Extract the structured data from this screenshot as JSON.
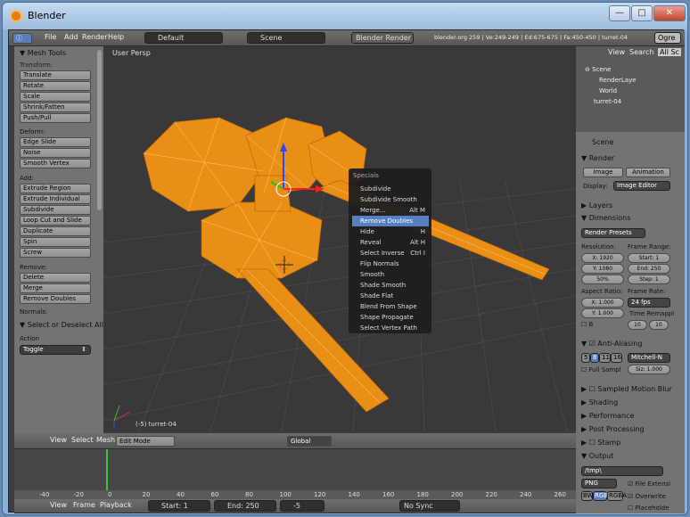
{
  "window": {
    "title": "Blender"
  },
  "info_header": {
    "menu": [
      "File",
      "Add",
      "Render",
      "Help"
    ],
    "layout": "Default",
    "scene": "Scene",
    "engine": "Blender Render",
    "stats": "blender.org 259 | Ve:249-249 | Ed:675-675 | Fa:450-450 | turret-04",
    "search_field": "Ogre"
  },
  "tool_panel": {
    "title": "Mesh Tools",
    "sections": [
      {
        "label": "Transform:",
        "buttons": [
          "Translate",
          "Rotate",
          "Scale",
          "Shrink/Fatten",
          "Push/Pull"
        ]
      },
      {
        "label": "Deform:",
        "buttons": [
          "Edge Slide",
          "Noise",
          "Smooth Vertex"
        ]
      },
      {
        "label": "Add:",
        "buttons": [
          "Extrude Region",
          "Extrude Individual",
          "Subdivide",
          "Loop Cut and Slide",
          "Duplicate",
          "Spin",
          "Screw"
        ]
      },
      {
        "label": "Remove:",
        "buttons": [
          "Delete",
          "Merge",
          "Remove Doubles"
        ]
      },
      {
        "label": "Normals:",
        "buttons": []
      }
    ],
    "operator": {
      "title": "Select or Deselect All",
      "action_label": "Action",
      "action_value": "Toggle"
    }
  },
  "viewport": {
    "label": "User Persp",
    "object_label": "(-5) turret-04"
  },
  "context_menu": {
    "title": "Specials",
    "items": [
      {
        "label": "Subdivide",
        "shortcut": ""
      },
      {
        "label": "Subdivide Smooth",
        "shortcut": ""
      },
      {
        "label": "Merge...",
        "shortcut": "Alt M"
      },
      {
        "label": "Remove Doubles",
        "shortcut": "",
        "selected": true
      },
      {
        "label": "Hide",
        "shortcut": "H"
      },
      {
        "label": "Reveal",
        "shortcut": "Alt H"
      },
      {
        "label": "Select Inverse",
        "shortcut": "Ctrl I"
      },
      {
        "label": "Flip Normals",
        "shortcut": ""
      },
      {
        "label": "Smooth",
        "shortcut": ""
      },
      {
        "label": "Shade Smooth",
        "shortcut": ""
      },
      {
        "label": "Shade Flat",
        "shortcut": ""
      },
      {
        "label": "Blend From Shape",
        "shortcut": ""
      },
      {
        "label": "Shape Propagate",
        "shortcut": ""
      },
      {
        "label": "Select Vertex Path",
        "shortcut": ""
      }
    ]
  },
  "view3d_header": {
    "menu": [
      "View",
      "Select",
      "Mesh"
    ],
    "mode": "Edit Mode",
    "orientation": "Global"
  },
  "outliner": {
    "header": [
      "View",
      "Search",
      "All Sc"
    ],
    "items": [
      "Scene",
      "RenderLaye",
      "World",
      "turret-04"
    ]
  },
  "properties": {
    "breadcrumb": "Scene",
    "render": {
      "title": "Render",
      "image_btn": "Image",
      "animation_btn": "Animation",
      "display_label": "Display:",
      "display_value": "Image Editor"
    },
    "layers": "Layers",
    "dimensions": "Dimensions",
    "presets": "Render Presets",
    "resolution_label": "Resolution:",
    "frame_range_label": "Frame Range:",
    "res_x": "X: 1920",
    "res_y": "Y: 1080",
    "res_pct": "50%",
    "start": "Start: 1",
    "end": "End: 250",
    "step": "Step: 1",
    "aspect_label": "Aspect Ratio:",
    "frame_rate_label": "Frame Rate:",
    "aspect_x": "X: 1.000",
    "aspect_y": "Y: 1.000",
    "fps": "24 fps",
    "time_remap": "Time Remappi",
    "b_label": "B",
    "remap_old": "10",
    "remap_new": "10",
    "aa": "Anti-Aliasing",
    "aa_samples": [
      "5",
      "8",
      "11",
      "16"
    ],
    "aa_filter": "Mitchell-N",
    "full_sample": "Full Sampl",
    "aa_size": "Siz: 1.000",
    "collapsed": [
      "Sampled Motion Blur",
      "Shading",
      "Performance",
      "Post Processing",
      "Stamp"
    ],
    "output": "Output",
    "output_path": "/tmp\\",
    "format": "PNG",
    "file_ext": "File Extensi",
    "overwrite": "Overwrite",
    "color_modes": [
      "BW",
      "RGB",
      "RGBA"
    ],
    "placeholder": "Placeholde"
  },
  "timeline": {
    "ruler": [
      "-40",
      "-20",
      "0",
      "20",
      "40",
      "60",
      "80",
      "100",
      "120",
      "140",
      "160",
      "180",
      "200",
      "220",
      "240",
      "260"
    ],
    "menu": [
      "View",
      "Frame",
      "Playback"
    ],
    "start": "Start: 1",
    "end": "End: 250",
    "current": "-5",
    "sync": "No Sync"
  },
  "colors": {
    "mesh": "#f39415",
    "menu_highlight": "#5680c2",
    "panel": "#737373",
    "viewport": "#393939"
  }
}
